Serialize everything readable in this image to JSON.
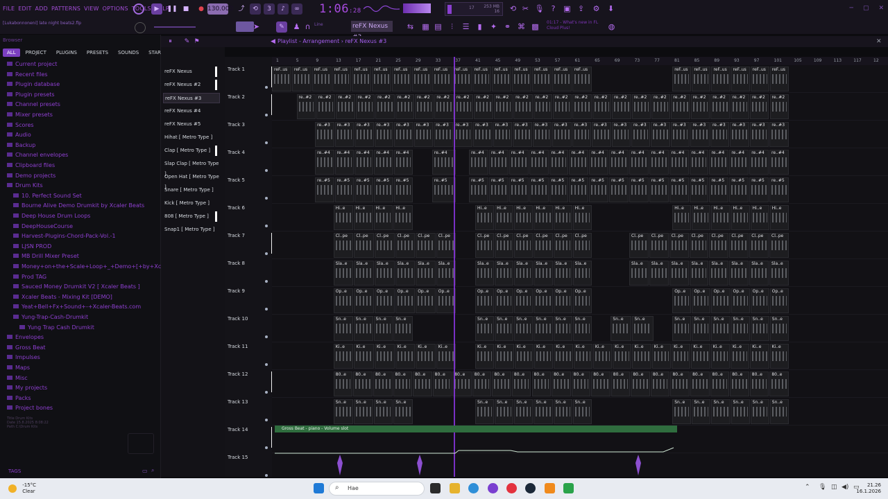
{
  "menu": [
    "FILE",
    "EDIT",
    "ADD",
    "PATTERNS",
    "VIEW",
    "OPTIONS",
    "TOOLS",
    "HELP"
  ],
  "toolbar": {
    "tempo": "130.000",
    "time_main": "1:06",
    "time_sub": ":28",
    "cpu_ram": "253 MB",
    "cpu_cores": "16",
    "cpu_small": "17"
  },
  "hint": "[Lukabonnoneni] late night beats2.flp",
  "pattern": "reFX Nexus #3",
  "snap_label": "Line",
  "news": [
    "01:17 - What's new in FL",
    "Cloud Plus!"
  ],
  "browser": {
    "title": "Browser",
    "tabs": [
      "ALL",
      "PROJECT",
      "PLUGINS",
      "PRESETS",
      "SOUNDS",
      "STARRED"
    ],
    "items": [
      {
        "label": "Current project",
        "indent": 0
      },
      {
        "label": "Recent files",
        "indent": 0
      },
      {
        "label": "Plugin database",
        "indent": 0
      },
      {
        "label": "Plugin presets",
        "indent": 0
      },
      {
        "label": "Channel presets",
        "indent": 0
      },
      {
        "label": "Mixer presets",
        "indent": 0
      },
      {
        "label": "Scores",
        "indent": 0
      },
      {
        "label": "Audio",
        "indent": 0
      },
      {
        "label": "Backup",
        "indent": 0
      },
      {
        "label": "Channel envelopes",
        "indent": 0
      },
      {
        "label": "Clipboard files",
        "indent": 0
      },
      {
        "label": "Demo projects",
        "indent": 0
      },
      {
        "label": "Drum Kits",
        "indent": 0
      },
      {
        "label": "10. Perfect Sound Set",
        "indent": 1
      },
      {
        "label": "Bourne Alive Demo Drumkit by Xcaler Beats",
        "indent": 1
      },
      {
        "label": "Deep House Drum Loops",
        "indent": 1
      },
      {
        "label": "DeepHouseCourse",
        "indent": 1
      },
      {
        "label": "Harvest-Plugins-Chord-Pack-Vol.-1",
        "indent": 1
      },
      {
        "label": "LJSN PROD",
        "indent": 1
      },
      {
        "label": "MB Drill Mixer Preset",
        "indent": 1
      },
      {
        "label": "Money+on+the+Scale+Loop+_+Demo+[+by+Xcaler+Beats+]",
        "indent": 1
      },
      {
        "label": "Prod TAG",
        "indent": 1
      },
      {
        "label": "Sauced Money Drumkit V2 [ Xcaler Beats ]",
        "indent": 1
      },
      {
        "label": "Xcaler Beats - Mixing Kit [DEMO]",
        "indent": 1
      },
      {
        "label": "Yeat+Bell+Fx+Sound+-+Xcaler-Beats.com",
        "indent": 1
      },
      {
        "label": "Yung-Trap-Cash-Drumkit",
        "indent": 1
      },
      {
        "label": "Yung Trap Cash Drumkit",
        "indent": 2
      },
      {
        "label": "Envelopes",
        "indent": 0
      },
      {
        "label": "Gross Beat",
        "indent": 0
      },
      {
        "label": "Impulses",
        "indent": 0
      },
      {
        "label": "Maps",
        "indent": 0
      },
      {
        "label": "Misc",
        "indent": 0
      },
      {
        "label": "My projects",
        "indent": 0
      },
      {
        "label": "Packs",
        "indent": 0
      },
      {
        "label": "Project bones",
        "indent": 0
      }
    ],
    "fileinfo": {
      "title": "Title    Drum Kits",
      "date": "Date     15.8.2025 8:08:22",
      "path": "Path     C:\\Drum Kits"
    },
    "tags_label": "TAGS"
  },
  "channels": [
    {
      "name": "reFX Nexus",
      "bar": true
    },
    {
      "name": "reFX Nexus #2",
      "bar": true
    },
    {
      "name": "reFX Nexus #3",
      "bar": false,
      "selected": true
    },
    {
      "name": "reFX Nexus #4",
      "bar": false
    },
    {
      "name": "reFX Nexus #5",
      "bar": false
    },
    {
      "name": "Hihat [ Metro Type ]",
      "bar": false
    },
    {
      "name": "Clap [ Metro Type ]",
      "bar": true
    },
    {
      "name": "Slap Clap [ Metro Type ]",
      "bar": false
    },
    {
      "name": "Open Hat [ Metro Type ]",
      "bar": false
    },
    {
      "name": "Snare [ Metro Type ]",
      "bar": false
    },
    {
      "name": "Kick [ Metro Type ]",
      "bar": false
    },
    {
      "name": "808 [ Metro Type ]",
      "bar": true
    },
    {
      "name": "Snap1 [ Metro Type ]",
      "bar": false
    }
  ],
  "playlist": {
    "title": "Playlist - Arrangement › reFX Nexus #3",
    "ruler": [
      "1",
      "5",
      "9",
      "13",
      "17",
      "21",
      "25",
      "29",
      "33",
      "37",
      "41",
      "45",
      "49",
      "53",
      "57",
      "61",
      "65",
      "69",
      "73",
      "77",
      "81",
      "85",
      "89",
      "93",
      "97",
      "101",
      "105",
      "109",
      "113",
      "117",
      "12"
    ],
    "tracks": [
      {
        "name": "Track 1",
        "bar": true,
        "clip": "reF..us",
        "segments": [
          [
            0,
            0.52
          ],
          [
            0.65,
            0.84
          ]
        ]
      },
      {
        "name": "Track 2",
        "bar": true,
        "clip": "re..#2",
        "segments": [
          [
            0.04,
            0.84
          ]
        ]
      },
      {
        "name": "Track 3",
        "bar": false,
        "clip": "re..#3",
        "segments": [
          [
            0.07,
            0.84
          ]
        ]
      },
      {
        "name": "Track 4",
        "bar": false,
        "clip": "re..#4",
        "segments": [
          [
            0.07,
            0.23
          ],
          [
            0.26,
            0.3
          ],
          [
            0.32,
            0.84
          ]
        ]
      },
      {
        "name": "Track 5",
        "bar": false,
        "clip": "re..#5",
        "segments": [
          [
            0.07,
            0.23
          ],
          [
            0.26,
            0.3
          ],
          [
            0.32,
            0.84
          ]
        ]
      },
      {
        "name": "Track 6",
        "bar": false,
        "clip": "Hi..e",
        "segments": [
          [
            0.1,
            0.23
          ],
          [
            0.33,
            0.52
          ],
          [
            0.65,
            0.84
          ]
        ]
      },
      {
        "name": "Track 7",
        "bar": true,
        "clip": "Cl..pe",
        "segments": [
          [
            0.1,
            0.3
          ],
          [
            0.33,
            0.52
          ],
          [
            0.58,
            0.84
          ]
        ]
      },
      {
        "name": "Track 8",
        "bar": false,
        "clip": "Sla..e",
        "segments": [
          [
            0.1,
            0.3
          ],
          [
            0.33,
            0.52
          ],
          [
            0.58,
            0.84
          ]
        ]
      },
      {
        "name": "Track 9",
        "bar": false,
        "clip": "Op..e",
        "segments": [
          [
            0.1,
            0.3
          ],
          [
            0.33,
            0.52
          ],
          [
            0.65,
            0.84
          ]
        ]
      },
      {
        "name": "Track 10",
        "bar": false,
        "clip": "Sn..e",
        "segments": [
          [
            0.1,
            0.23
          ],
          [
            0.33,
            0.52
          ],
          [
            0.55,
            0.62
          ],
          [
            0.65,
            0.84
          ]
        ]
      },
      {
        "name": "Track 11",
        "bar": false,
        "clip": "Ki..e",
        "segments": [
          [
            0.1,
            0.3
          ],
          [
            0.33,
            0.84
          ]
        ]
      },
      {
        "name": "Track 12",
        "bar": true,
        "clip": "80..e",
        "segments": [
          [
            0.1,
            0.84
          ]
        ]
      },
      {
        "name": "Track 13",
        "bar": false,
        "clip": "Sn..e",
        "segments": [
          [
            0.1,
            0.23
          ],
          [
            0.33,
            0.52
          ],
          [
            0.65,
            0.84
          ]
        ]
      },
      {
        "name": "Track 14",
        "bar": true,
        "clip": "",
        "segments": []
      },
      {
        "name": "Track 15",
        "bar": false,
        "clip": "",
        "segments": []
      }
    ],
    "automation_label": "Gross Beat - piano - Volume slot"
  },
  "taskbar": {
    "temp": "-15°C",
    "condition": "Clear",
    "search": "Hae",
    "time": "21.26",
    "date": "16.1.2026"
  }
}
